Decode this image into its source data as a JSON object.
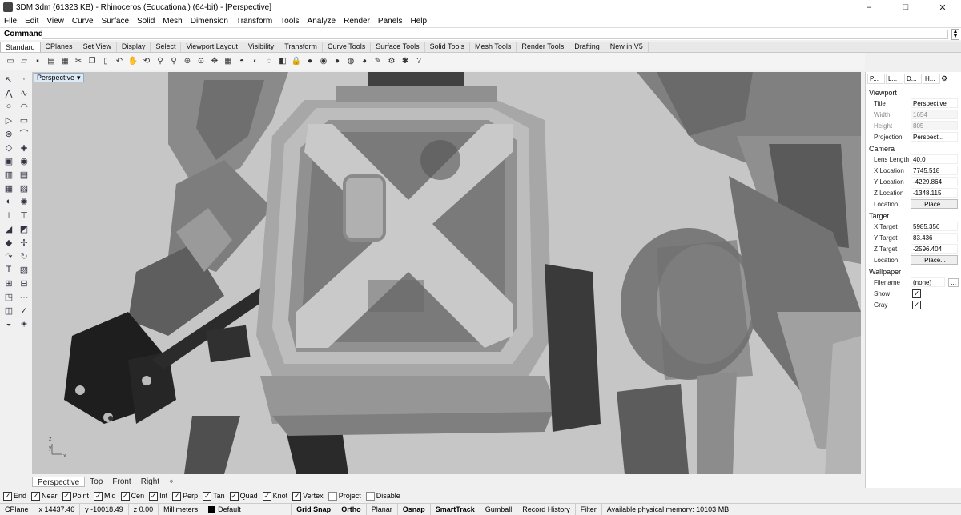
{
  "window": {
    "title": "3DM.3dm (61323 KB) - Rhinoceros (Educational) (64-bit) - [Perspective]",
    "minimize": "–",
    "maximize": "□",
    "close": "✕"
  },
  "menu": [
    "File",
    "Edit",
    "View",
    "Curve",
    "Surface",
    "Solid",
    "Mesh",
    "Dimension",
    "Transform",
    "Tools",
    "Analyze",
    "Render",
    "Panels",
    "Help"
  ],
  "command": {
    "label": "Command:",
    "value": ""
  },
  "toolbar_tabs": [
    "Standard",
    "CPlanes",
    "Set View",
    "Display",
    "Select",
    "Viewport Layout",
    "Visibility",
    "Transform",
    "Curve Tools",
    "Surface Tools",
    "Solid Tools",
    "Mesh Tools",
    "Render Tools",
    "Drafting",
    "New in V5"
  ],
  "viewport": {
    "label": "Perspective"
  },
  "viewport_tabs": [
    "Perspective",
    "Top",
    "Front",
    "Right",
    "⌖"
  ],
  "panel": {
    "tabs": [
      "P...",
      "L...",
      "D...",
      "H..."
    ],
    "sections": {
      "viewport": {
        "header": "Viewport",
        "rows": [
          {
            "k": "Title",
            "v": "Perspective"
          },
          {
            "k": "Width",
            "v": "1654"
          },
          {
            "k": "Height",
            "v": "805"
          },
          {
            "k": "Projection",
            "v": "Perspect..."
          }
        ]
      },
      "camera": {
        "header": "Camera",
        "rows": [
          {
            "k": "Lens Length",
            "v": "40.0"
          },
          {
            "k": "X Location",
            "v": "7745.518"
          },
          {
            "k": "Y Location",
            "v": "-4229.864"
          },
          {
            "k": "Z Location",
            "v": "-1348.115"
          },
          {
            "k": "Location",
            "v": "Place..."
          }
        ]
      },
      "target": {
        "header": "Target",
        "rows": [
          {
            "k": "X Target",
            "v": "5985.356"
          },
          {
            "k": "Y Target",
            "v": "83.436"
          },
          {
            "k": "Z Target",
            "v": "-2596.404"
          },
          {
            "k": "Location",
            "v": "Place..."
          }
        ]
      },
      "wallpaper": {
        "header": "Wallpaper",
        "rows": [
          {
            "k": "Filename",
            "v": "(none)"
          },
          {
            "k": "Show",
            "v": "✓"
          },
          {
            "k": "Gray",
            "v": "✓"
          }
        ]
      }
    }
  },
  "osnaps": [
    {
      "label": "End",
      "on": true
    },
    {
      "label": "Near",
      "on": true
    },
    {
      "label": "Point",
      "on": true
    },
    {
      "label": "Mid",
      "on": true
    },
    {
      "label": "Cen",
      "on": true
    },
    {
      "label": "Int",
      "on": true
    },
    {
      "label": "Perp",
      "on": true
    },
    {
      "label": "Tan",
      "on": true
    },
    {
      "label": "Quad",
      "on": true
    },
    {
      "label": "Knot",
      "on": true
    },
    {
      "label": "Vertex",
      "on": true
    },
    {
      "label": "Project",
      "on": false
    },
    {
      "label": "Disable",
      "on": false
    }
  ],
  "status": {
    "cplane": "CPlane",
    "x": "x 14437.46",
    "y": "y -10018.49",
    "z": "z 0.00",
    "units": "Millimeters",
    "layer": "Default",
    "grid_snap": "Grid Snap",
    "ortho": "Ortho",
    "planar": "Planar",
    "osnap": "Osnap",
    "smarttrack": "SmartTrack",
    "gumball": "Gumball",
    "record_history": "Record History",
    "filter": "Filter",
    "memory": "Available physical memory: 10103 MB"
  },
  "checkmark": "✓",
  "axis": {
    "z": "z",
    "y": "y",
    "x": "x"
  },
  "more_button": "..."
}
